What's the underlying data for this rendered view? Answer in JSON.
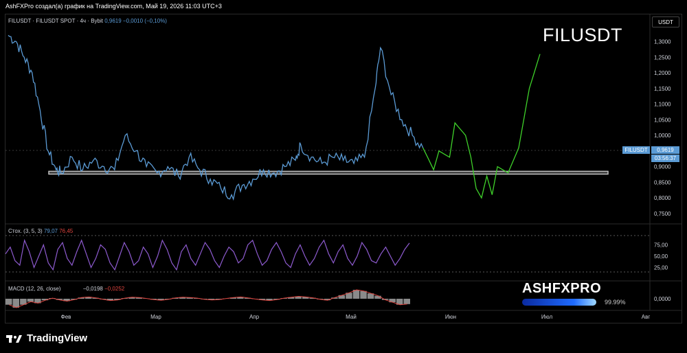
{
  "header": {
    "text": "AshFXPro создал(а) график на TradingView.com, Май 19, 2026 11:03 UTC+3"
  },
  "symbol": {
    "name": "FILUSDT · FILUSDT SPOT · 4ч · Bybit",
    "price": "0,9619",
    "change": "−0,0010 (−0,10%)"
  },
  "currency_button": "USDT",
  "big_label": "FILUSDT",
  "price_tag": {
    "label": "FILUSDT",
    "price": "0,9619",
    "timer": "03:56:37"
  },
  "stoch": {
    "label": "Стох. (3, 5, 3)",
    "k": "79,07",
    "d": "76,45"
  },
  "macd": {
    "label": "MACD (12, 26, close)",
    "v1": "−0,0198",
    "v2": "−0,0252"
  },
  "watermark": {
    "brand": "ASHFXPRO",
    "pct": "99.99%",
    "fill": 0.9999
  },
  "footer": {
    "brand": "TradingView"
  },
  "colors": {
    "price_line": "#5b9bd5",
    "projection": "#3fd22a",
    "stoch_line": "#8e5bd0",
    "macd_line": "#e0443e",
    "support_box": "#bfbfbf"
  },
  "chart_data": [
    {
      "type": "line",
      "title": "FILUSDT",
      "x_ticks": [
        "Фев",
        "Мар",
        "Апр",
        "Май",
        "Июн",
        "Июл",
        "Авг"
      ],
      "y_ticks": [
        "1,3000",
        "1,2500",
        "1,2000",
        "1,1500",
        "1,1000",
        "1,0500",
        "1,0000",
        "0,9500",
        "0,9000",
        "0,8500",
        "0,8000",
        "0,7500"
      ],
      "ylim": [
        0.73,
        1.345
      ],
      "support_zone": [
        0.876,
        0.885
      ],
      "series": [
        {
          "role": "price",
          "points": [
            [
              0,
              1.32
            ],
            [
              0.015,
              1.3
            ],
            [
              0.03,
              1.25
            ],
            [
              0.045,
              1.2
            ],
            [
              0.06,
              1.08
            ],
            [
              0.075,
              0.95
            ],
            [
              0.09,
              0.89
            ],
            [
              0.1,
              0.88
            ],
            [
              0.12,
              0.93
            ],
            [
              0.14,
              0.89
            ],
            [
              0.16,
              0.92
            ],
            [
              0.18,
              0.9
            ],
            [
              0.2,
              0.89
            ],
            [
              0.22,
              1.0
            ],
            [
              0.24,
              0.95
            ],
            [
              0.26,
              0.9
            ],
            [
              0.28,
              0.88
            ],
            [
              0.3,
              0.9
            ],
            [
              0.32,
              0.87
            ],
            [
              0.34,
              0.93
            ],
            [
              0.36,
              0.89
            ],
            [
              0.38,
              0.86
            ],
            [
              0.4,
              0.83
            ],
            [
              0.42,
              0.81
            ],
            [
              0.44,
              0.84
            ],
            [
              0.46,
              0.86
            ],
            [
              0.48,
              0.89
            ],
            [
              0.5,
              0.88
            ],
            [
              0.52,
              0.9
            ],
            [
              0.54,
              0.92
            ],
            [
              0.55,
              0.97
            ],
            [
              0.57,
              0.93
            ],
            [
              0.59,
              0.91
            ],
            [
              0.61,
              0.93
            ],
            [
              0.63,
              0.92
            ],
            [
              0.65,
              0.91
            ],
            [
              0.67,
              0.93
            ],
            [
              0.69,
              1.15
            ],
            [
              0.7,
              1.28
            ],
            [
              0.72,
              1.13
            ],
            [
              0.74,
              1.05
            ],
            [
              0.76,
              1.0
            ],
            [
              0.78,
              0.96
            ]
          ]
        },
        {
          "role": "projection",
          "points": [
            [
              0.78,
              0.96
            ],
            [
              0.8,
              0.89
            ],
            [
              0.81,
              0.95
            ],
            [
              0.83,
              0.93
            ],
            [
              0.84,
              1.04
            ],
            [
              0.86,
              1.0
            ],
            [
              0.87,
              0.93
            ],
            [
              0.88,
              0.83
            ],
            [
              0.89,
              0.8
            ],
            [
              0.9,
              0.87
            ],
            [
              0.91,
              0.81
            ],
            [
              0.92,
              0.9
            ],
            [
              0.94,
              0.88
            ],
            [
              0.96,
              0.96
            ],
            [
              0.98,
              1.15
            ],
            [
              1.0,
              1.26
            ]
          ]
        }
      ]
    },
    {
      "type": "line",
      "title": "Стох. (3, 5, 3)",
      "y_ticks": [
        "75,00",
        "50,00",
        "25,00"
      ],
      "levels": [
        80,
        20
      ],
      "ylim": [
        0,
        100
      ],
      "values": [
        55,
        70,
        40,
        30,
        85,
        60,
        25,
        50,
        75,
        35,
        20,
        65,
        80,
        45,
        30,
        60,
        85,
        55,
        25,
        45,
        75,
        65,
        35,
        20,
        50,
        80,
        60,
        30,
        40,
        70,
        55,
        25,
        50,
        85,
        65,
        35,
        20,
        60,
        75,
        45,
        30,
        55,
        80,
        65,
        40,
        25,
        50,
        70,
        60,
        35,
        45,
        75,
        85,
        55,
        30,
        40,
        65,
        80,
        60,
        35,
        25,
        55,
        75,
        50,
        30,
        45,
        70,
        85,
        55,
        35,
        60,
        75,
        45,
        30,
        50,
        80,
        65,
        40,
        35,
        55,
        70,
        50,
        30,
        45,
        65,
        79
      ]
    },
    {
      "type": "bar",
      "title": "MACD (12, 26, close)",
      "y_ticks": [
        "0,0000"
      ],
      "ylim": [
        -0.06,
        0.06
      ],
      "values": [
        -0.02,
        -0.03,
        -0.02,
        -0.01,
        -0.015,
        -0.005,
        0.002,
        -0.004,
        -0.008,
        -0.003,
        0.004,
        0.006,
        0.003,
        -0.002,
        -0.006,
        -0.004,
        0.002,
        0.005,
        0.004,
        0.001,
        -0.003,
        -0.005,
        -0.002,
        0.003,
        0.005,
        0.004,
        0.002,
        -0.002,
        -0.004,
        -0.003,
        0.001,
        0.004,
        0.006,
        0.003,
        -0.001,
        -0.004,
        -0.006,
        -0.003,
        0.002,
        0.005,
        0.008,
        0.006,
        0.003,
        -0.002,
        -0.005,
        0.004,
        0.012,
        0.02,
        0.03,
        0.026,
        0.018,
        0.01,
        -0.004,
        -0.012,
        -0.02,
        -0.018
      ]
    }
  ]
}
